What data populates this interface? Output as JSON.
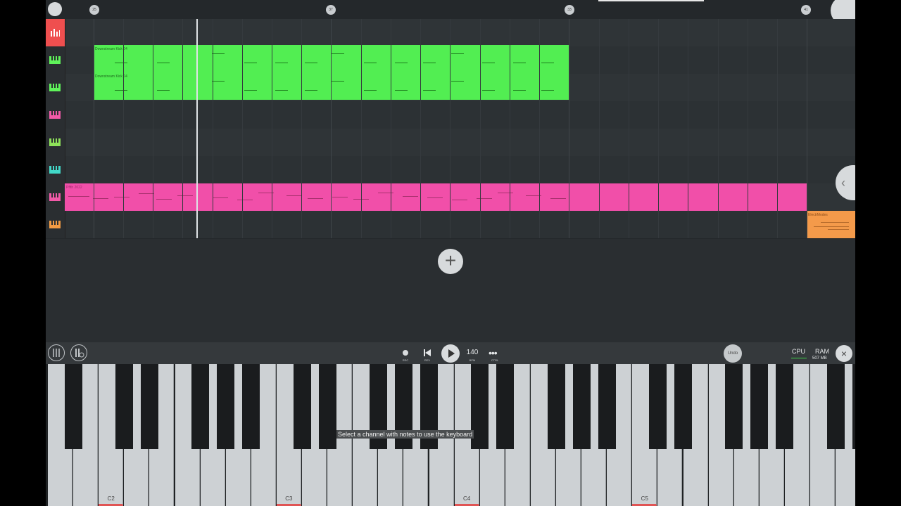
{
  "ruler": {
    "markers": [
      "25",
      "37",
      "33",
      "41"
    ]
  },
  "tracks": [
    {
      "name": "track-1",
      "icon": "mixer-icon",
      "color": "#ef4f4f"
    },
    {
      "name": "track-2",
      "icon": "piano-icon",
      "color": "#5ff35a"
    },
    {
      "name": "track-3",
      "icon": "piano-icon",
      "color": "#5ff35a"
    },
    {
      "name": "track-4",
      "icon": "piano-icon",
      "color": "#f25aa8"
    },
    {
      "name": "track-5",
      "icon": "piano-icon",
      "color": "#8fe35a"
    },
    {
      "name": "track-6",
      "icon": "piano-icon",
      "color": "#41d8c8"
    },
    {
      "name": "track-7",
      "icon": "piano-icon",
      "color": "#f25aa8"
    },
    {
      "name": "track-8",
      "icon": "piano-icon",
      "color": "#f29a43"
    }
  ],
  "clips": [
    {
      "label": "Downstream Kick 04",
      "color": "#52ee52",
      "track": 1
    },
    {
      "label": "Downstream Kick 04",
      "color": "#52ee52",
      "track": 2
    },
    {
      "label": "Pffth 2022",
      "color": "#f14fa9",
      "track": 6
    },
    {
      "label": "ElectrModes",
      "color": "#f49a4a",
      "track": 7
    }
  ],
  "toolbar": {
    "rec_label": "REC",
    "rev_label": "REV",
    "bpm_value": "140",
    "bpm_label": "BPM",
    "more_label": "CTRL",
    "undo_label": "Undo",
    "cpu_label": "CPU",
    "ram_label": "RAM",
    "ram_value": "507 MB",
    "close_icon": "close-icon"
  },
  "keyboard": {
    "hint": "Select a channel with notes to use the keyboard",
    "octave_labels": [
      "C2",
      "C3",
      "C4",
      "C5"
    ]
  },
  "colors": {
    "background": "#2a2e31",
    "accent_green": "#52ee52",
    "accent_pink": "#f14fa9",
    "accent_orange": "#f49a4a",
    "accent_red": "#ef4f4f"
  }
}
